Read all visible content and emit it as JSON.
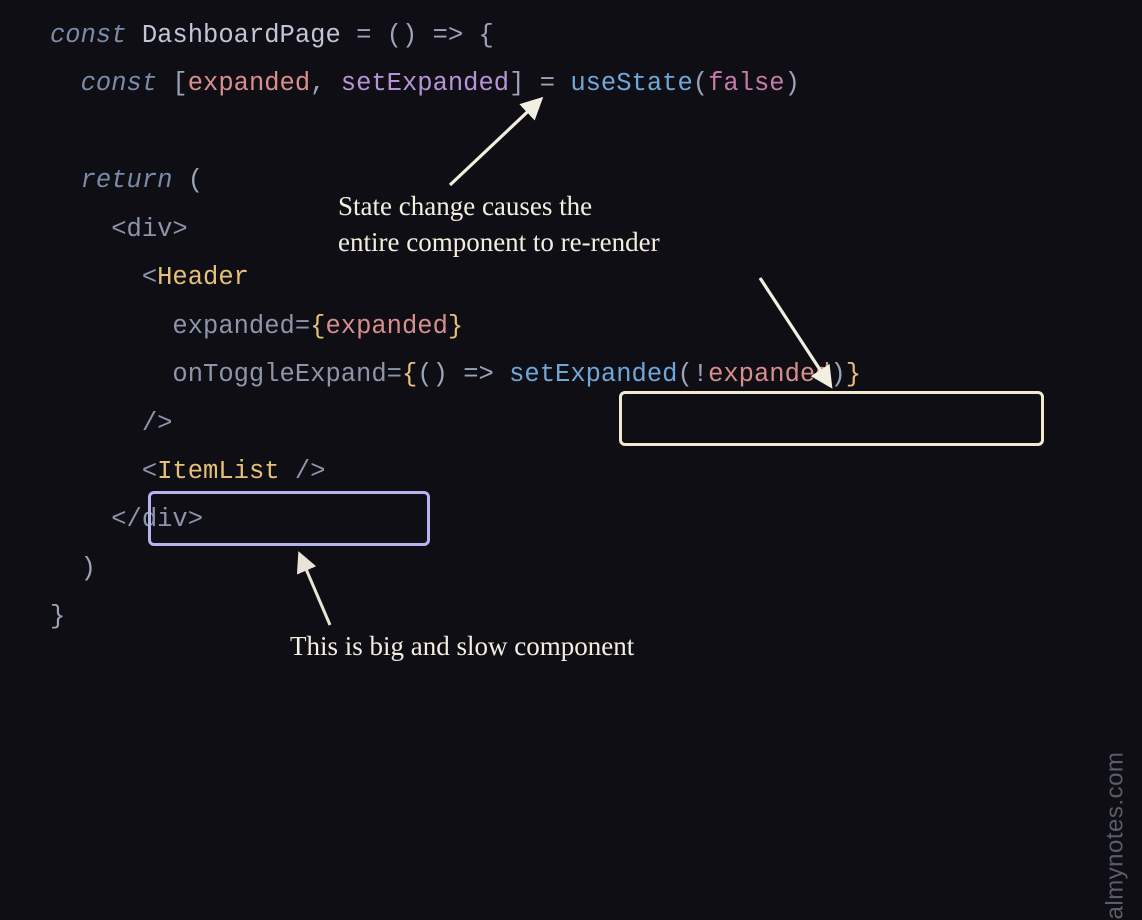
{
  "code": {
    "l1_kw": "const ",
    "l1_fn": "DashboardPage",
    "l1_rest": " = () => {",
    "l2_kw": "  const ",
    "l2_br1": "[",
    "l2_v1": "expanded",
    "l2_comma": ", ",
    "l2_v2": "setExpanded",
    "l2_br2": "]",
    "l2_eq": " = ",
    "l2_call": "useState",
    "l2_p1": "(",
    "l2_bool": "false",
    "l2_p2": ")",
    "l4_kw": "  return ",
    "l4_paren": "(",
    "l5_divO": "    <div>",
    "l6_a": "      <",
    "l6_comp": "Header",
    "l7_attr": "        expanded=",
    "l7_b1": "{",
    "l7_v": "expanded",
    "l7_b2": "}",
    "l8_attr": "        onToggleExpand=",
    "l8_b1": "{",
    "l8_arrow": "() => ",
    "l8_call": "setExpanded",
    "l8_p1": "(",
    "l8_neg": "!",
    "l8_v": "expanded",
    "l8_p2": ")",
    "l8_b2": "}",
    "l9_close": "      />",
    "l10_a": "      <",
    "l10_comp": "ItemList",
    "l10_b": " />",
    "l11_divC": "    </div>",
    "l12_paren": "  )",
    "l13_brace": "}"
  },
  "annotations": {
    "top": "State change causes the\nentire component to re-render",
    "bottom": "This is big and slow component"
  },
  "watermark": "almynotes.com"
}
